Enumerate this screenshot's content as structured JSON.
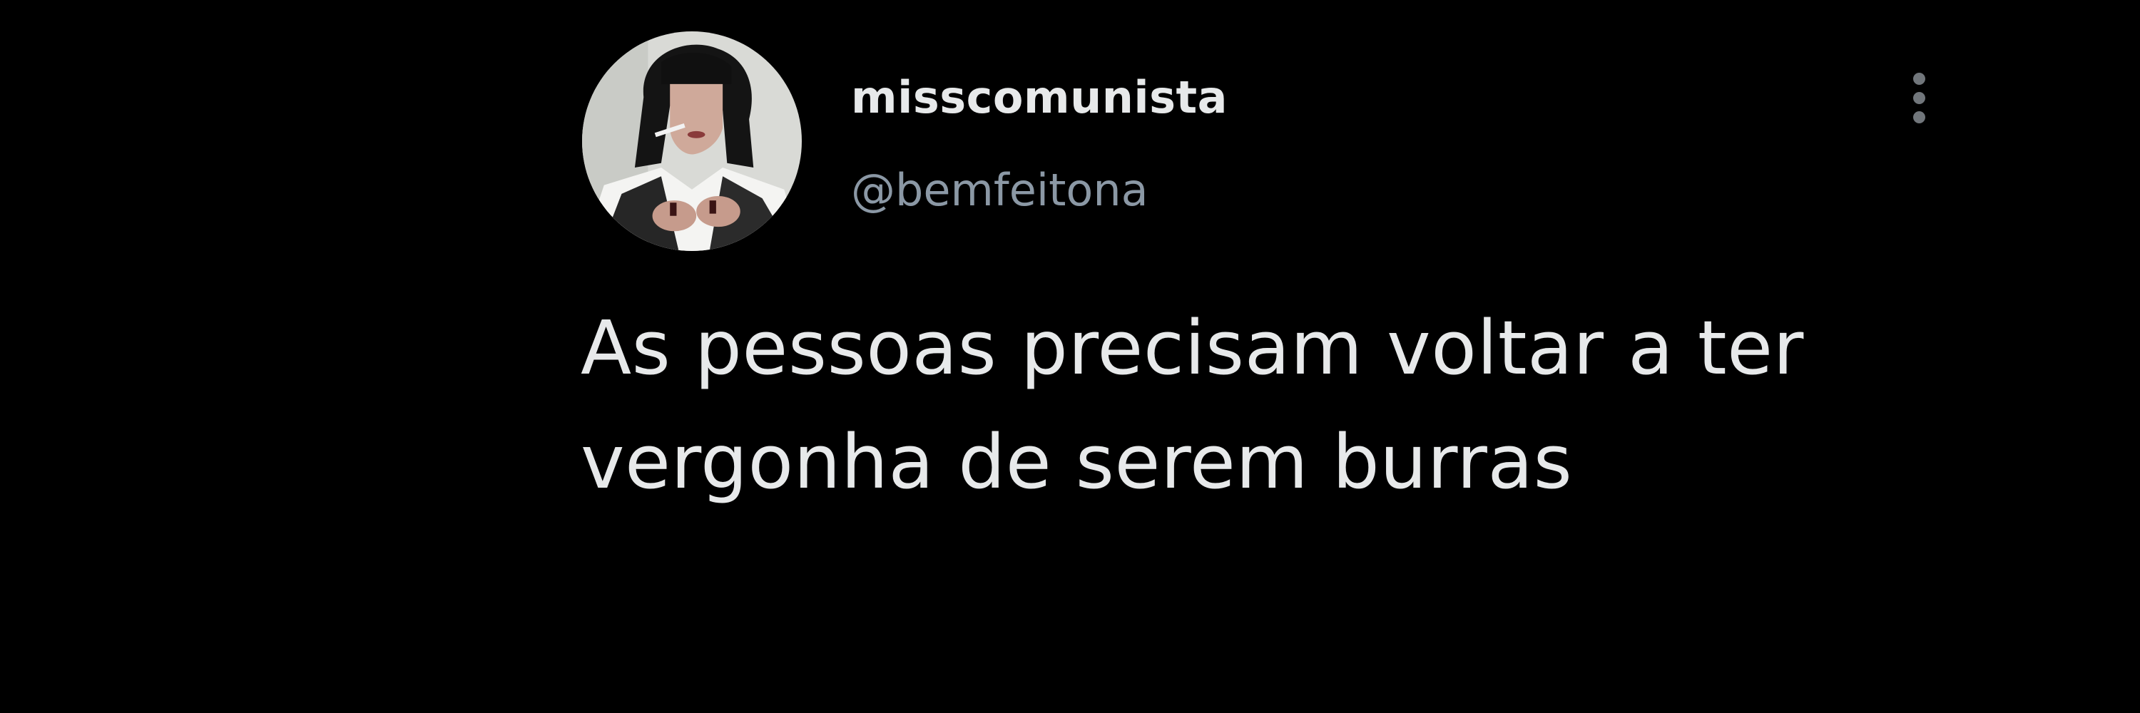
{
  "tweet": {
    "author": {
      "display_name": "misscomunista",
      "handle": "@bemfeitona",
      "avatar_icon": "profile-photo"
    },
    "text": "As pessoas precisam voltar a ter vergonha de serem burras",
    "more_icon": "more-vertical-icon"
  },
  "colors": {
    "background": "#000000",
    "primary_text": "#e7e9ea",
    "secondary_text": "#8b98a5",
    "icon": "#71767b"
  }
}
